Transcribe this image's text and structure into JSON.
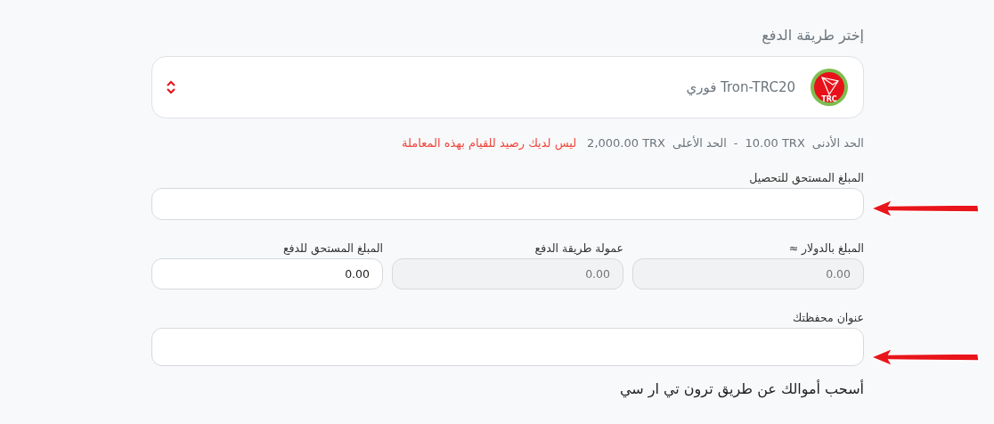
{
  "heading": "إختر طريقة الدفع",
  "payment_method": {
    "label": "Tron-TRC20 فوري",
    "icon_text": "TRC"
  },
  "limits": {
    "min_label": "الحد الأدنى",
    "min_value": "10.00 TRX",
    "separator": "-",
    "max_label": "الحد الأعلى",
    "max_value": "2,000.00 TRX",
    "error": "ليس لديك رصيد للقيام بهذه المعاملة"
  },
  "amount_due": {
    "label": "المبلغ المستحق للتحصيل",
    "annotated": true
  },
  "amounts": [
    {
      "label": "المبلغ بالدولار ≈",
      "placeholder": "0.00",
      "disabled": true
    },
    {
      "label": "عمولة طريقة الدفع",
      "placeholder": "0.00",
      "disabled": true
    },
    {
      "label": "المبلغ المستحق للدفع",
      "value": "0.00",
      "disabled": false
    }
  ],
  "wallet": {
    "label": "عنوان محفظتك",
    "annotated": true
  },
  "footer": "أسحب أموالك عن طريق ترون تي ار سي"
}
